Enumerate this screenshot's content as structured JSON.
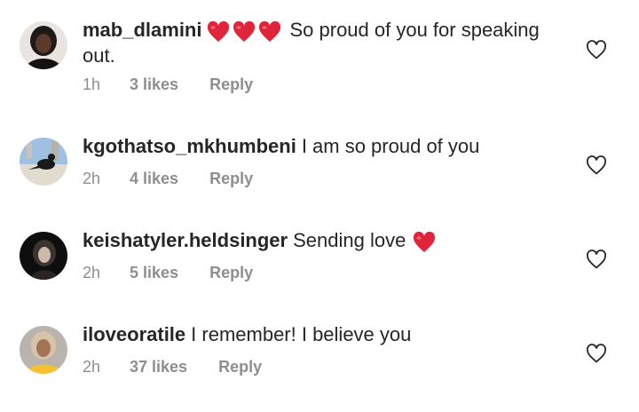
{
  "comments": [
    {
      "username": "mab_dlamini",
      "hearts": 3,
      "text": "So proud of you for speaking out.",
      "time": "1h",
      "likes": "3 likes",
      "reply": "Reply"
    },
    {
      "username": "kgothatso_mkhumbeni",
      "hearts": 0,
      "text": "I am so proud of you",
      "time": "2h",
      "likes": "4 likes",
      "reply": "Reply"
    },
    {
      "username": "keishatyler.heldsinger",
      "hearts": 0,
      "text": "Sending love",
      "trailing_heart": true,
      "time": "2h",
      "likes": "5 likes",
      "reply": "Reply"
    },
    {
      "username": "iloveoratile",
      "hearts": 0,
      "text": "I remember! I believe you",
      "time": "2h",
      "likes": "37 likes",
      "reply": "Reply"
    }
  ],
  "colors": {
    "heart_emoji": "#e0243a",
    "meta_text": "#8e8e8e",
    "body_text": "#262626"
  },
  "icons": {
    "like": "heart-outline-icon",
    "emoji": "red-heart-emoji"
  }
}
